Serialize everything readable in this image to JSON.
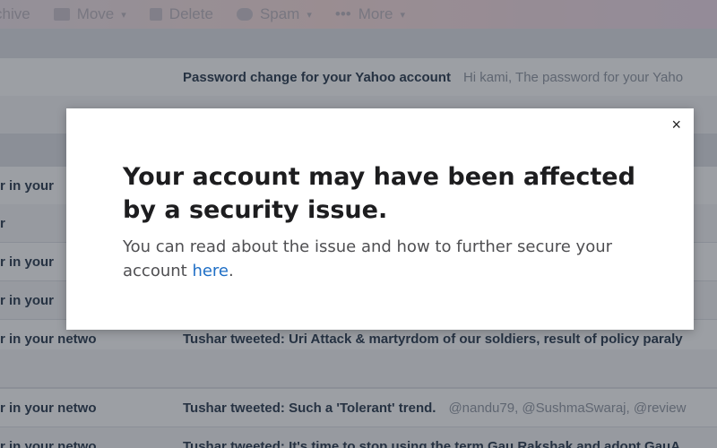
{
  "toolbar": {
    "items": [
      {
        "label": "chive",
        "icon": "archive-icon"
      },
      {
        "label": "Move",
        "icon": "folder-icon"
      },
      {
        "label": "Delete",
        "icon": "trash-icon"
      },
      {
        "label": "Spam",
        "icon": "shield-icon"
      },
      {
        "label": "More",
        "icon": "more-icon"
      }
    ]
  },
  "messages": [
    {
      "sender": "",
      "subject": "Password change for your Yahoo account",
      "snippet": "Hi kami, The password for your Yaho"
    },
    {
      "sender": "",
      "subject": "",
      "snippet": ""
    },
    {
      "sender": "r in your",
      "subject": "",
      "snippet": ""
    },
    {
      "sender": "r",
      "subject": "",
      "snippet": ""
    },
    {
      "sender": "r in your",
      "subject": "",
      "snippet": ""
    },
    {
      "sender": "r in your",
      "subject": "",
      "snippet": ""
    },
    {
      "sender": "r in your netwo",
      "subject": "Tushar tweeted: Uri Attack & martyrdom of our soldiers, result of policy paraly",
      "snippet": ""
    },
    {
      "sender": "",
      "subject": "",
      "snippet": ""
    },
    {
      "sender": "r in your netwo",
      "subject": "Tushar tweeted: Such a 'Tolerant' trend.",
      "snippet": "@nandu79, @SushmaSwaraj, @review"
    },
    {
      "sender": "r in your netwo",
      "subject": "Tushar tweeted: It's time to stop using the term Gau Rakshak and adopt GauA",
      "snippet": ""
    }
  ],
  "modal": {
    "close_label": "×",
    "title": "Your account may have been affected by a security issue.",
    "body_text": "You can read about the issue and how to further secure your account ",
    "link_text": "here",
    "body_end": "."
  }
}
